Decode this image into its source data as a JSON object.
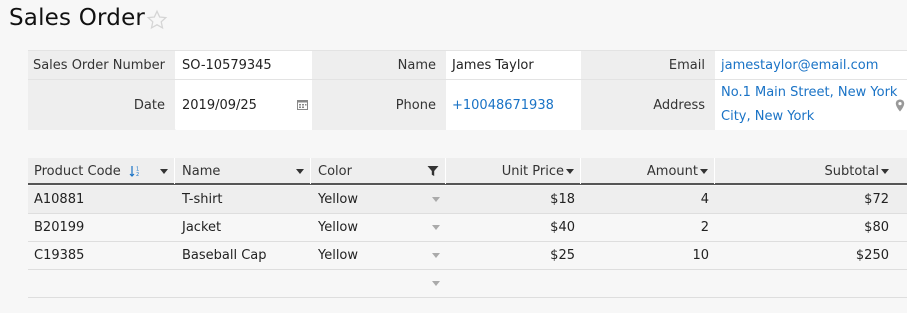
{
  "page": {
    "title": "Sales Order"
  },
  "form": {
    "order_number_label": "Sales Order Number",
    "order_number_value": "SO-10579345",
    "name_label": "Name",
    "name_value": "James Taylor",
    "email_label": "Email",
    "email_value": "jamestaylor@email.com",
    "date_label": "Date",
    "date_value": "2019/09/25",
    "phone_label": "Phone",
    "phone_value": "+10048671938",
    "address_label": "Address",
    "address_line1": "No.1 Main Street, New York",
    "address_line2": "City, New York"
  },
  "grid": {
    "columns": {
      "product_code": "Product Code",
      "name": "Name",
      "color": "Color",
      "unit_price": "Unit Price",
      "amount": "Amount",
      "subtotal": "Subtotal"
    },
    "rows": [
      {
        "product_code": "A10881",
        "name": "T-shirt",
        "color": "Yellow",
        "unit_price": "$18",
        "amount": "4",
        "subtotal": "$72"
      },
      {
        "product_code": "B20199",
        "name": "Jacket",
        "color": "Yellow",
        "unit_price": "$40",
        "amount": "2",
        "subtotal": "$80"
      },
      {
        "product_code": "C19385",
        "name": "Baseball Cap",
        "color": "Yellow",
        "unit_price": "$25",
        "amount": "10",
        "subtotal": "$250"
      }
    ]
  },
  "colors": {
    "link": "#1a73c6",
    "label_bg": "#eeeeee",
    "accent_sort": "#1a73c6"
  },
  "icons": [
    "star-icon",
    "calendar-icon",
    "location-pin-icon",
    "sort-icon",
    "filter-icon",
    "dropdown-icon"
  ]
}
